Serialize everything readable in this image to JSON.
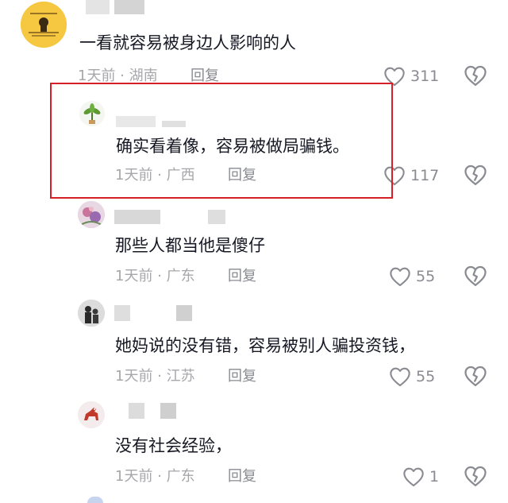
{
  "comments": [
    {
      "text": "一看就容易被身边人影响的人",
      "meta": "1天前 · 湖南",
      "reply_label": "回复",
      "likes": "311",
      "avatar_icon": "yellow-text-avatar"
    },
    {
      "text": "确实看着像，容易被做局骗钱。",
      "meta": "1天前 · 广西",
      "reply_label": "回复",
      "likes": "117",
      "avatar_icon": "plant-avatar"
    },
    {
      "text": "那些人都当他是傻仔",
      "meta": "1天前 · 广东",
      "reply_label": "回复",
      "likes": "55",
      "avatar_icon": "floral-avatar"
    },
    {
      "text": "她妈说的没有错，容易被别人骗投资钱，",
      "meta": "1天前 · 江苏",
      "reply_label": "回复",
      "likes": "55",
      "avatar_icon": "people-avatar"
    },
    {
      "text": "没有社会经验，",
      "meta": "1天前 · 广东",
      "reply_label": "回复",
      "likes": "1",
      "avatar_icon": "horse-avatar"
    }
  ],
  "colors": {
    "highlight": "#d61f26",
    "text": "#161823",
    "meta": "#a7a7ab",
    "icon": "#8a8b91"
  }
}
